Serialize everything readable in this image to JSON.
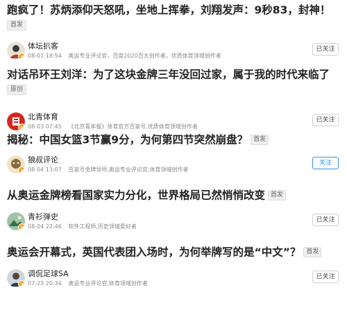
{
  "articles": [
    {
      "title": "跑疯了！苏炳添仰天怒吼，坐地上挥拳，刘翔发声：9秒83，封神！",
      "badge": "首发",
      "author": "体坛扒客",
      "time": "08-01 18:54",
      "tags": [
        "奥运专业评论官，百度2020百大创作者，优质体育领域创作者"
      ],
      "follow_label": "已关注"
    },
    {
      "title": "对话吊环王刘洋：为了这块金牌三年没回过家，属于我的时代来临了",
      "badge": "原创",
      "author": "北青体育",
      "time": "08-03 07:45",
      "tags": [
        "《北京青年报》体育官方百家号,优质体育领域创作者"
      ],
      "follow_label": "已关注"
    },
    {
      "title": "揭秘：中国女篮3节赢9分，为何第四节突然崩盘？",
      "badge": "首发",
      "author": "狼叔评论",
      "time": "08-04 13:07",
      "tags": [
        "百家号金牌导师,奥运专业评论官,体育领域创作者"
      ],
      "follow_label": "关注"
    },
    {
      "title": "从奥运金牌榜看国家实力分化，世界格局已然悄悄改变",
      "badge": "首发",
      "author": "青衫弹史",
      "time": "08-04 22:46",
      "tags": [
        "软件工程师,历史领域爱好者"
      ],
      "follow_label": "已关注"
    },
    {
      "title": "奥运会开幕式，英国代表团入场时，为何举牌写的是“中文”？",
      "badge": "首发",
      "author": "调侃足球SA",
      "time": "07-23 20:34",
      "tags": [
        "奥运专业评论官,体育领域创作者"
      ],
      "follow_label": "已关注"
    }
  ],
  "colors": {
    "follow_active": "#3a8ee6",
    "verified": "#f5a623"
  }
}
